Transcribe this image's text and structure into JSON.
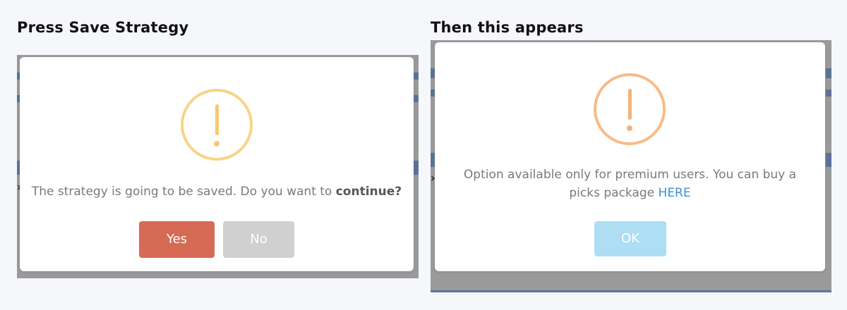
{
  "left_panel": {
    "heading": "Press Save Strategy",
    "dialog": {
      "icon": "warning-exclamation-icon",
      "message_prefix": "The strategy is going to be saved. Do you want to ",
      "message_emphasis": "continue?",
      "yes_label": "Yes",
      "no_label": "No"
    }
  },
  "right_panel": {
    "heading": "Then this appears",
    "dialog": {
      "icon": "warning-exclamation-icon",
      "message_prefix": "Option available only for premium users. You can buy a picks package ",
      "message_link": "HERE",
      "ok_label": "OK"
    }
  },
  "colors": {
    "yes_button": "#d66a55",
    "no_button": "#d0d0d0",
    "ok_button": "#aedef4",
    "warning_left": "#f8d486",
    "warning_right": "#f8bb86",
    "link": "#3d8fd4"
  }
}
